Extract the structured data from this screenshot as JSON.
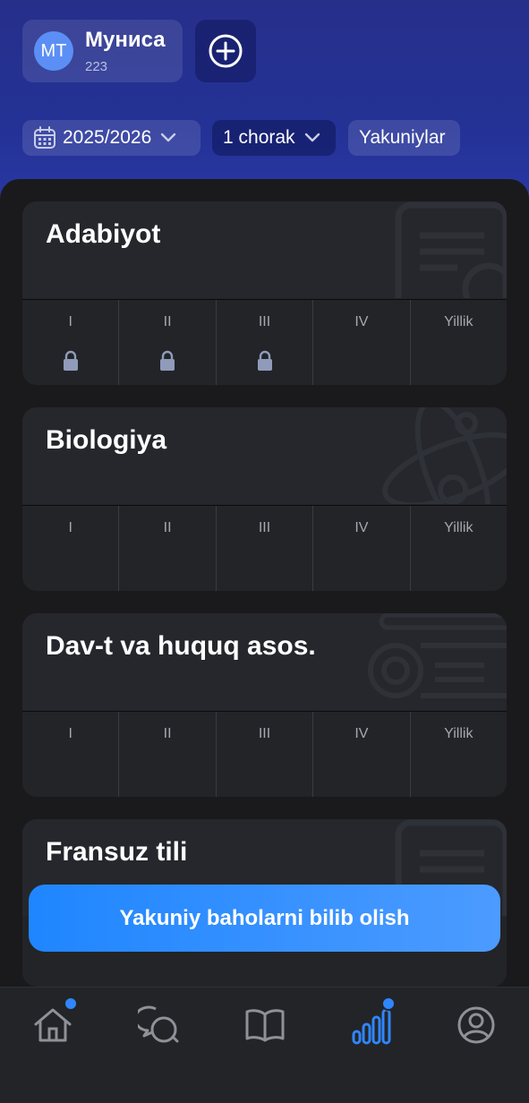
{
  "profile": {
    "initials": "MT",
    "name": "Муниса",
    "subtitle": "223"
  },
  "filters": {
    "year": "2025/2026",
    "quarter": "1 chorak",
    "results": "Yakuniylar"
  },
  "grade_columns": [
    "I",
    "II",
    "III",
    "IV",
    "Yillik"
  ],
  "subjects": [
    {
      "name": "Adabiyot",
      "locked": [
        true,
        true,
        true,
        false,
        false
      ]
    },
    {
      "name": "Biologiya",
      "locked": [
        false,
        false,
        false,
        false,
        false
      ]
    },
    {
      "name": "Dav-t va huquq asos.",
      "locked": [
        false,
        false,
        false,
        false,
        false
      ]
    },
    {
      "name": "Fransuz tili",
      "locked": [
        false,
        false,
        false,
        false,
        false
      ]
    }
  ],
  "cta": {
    "label": "Yakuniy baholarni bilib olish"
  },
  "tabbar": {
    "items": [
      {
        "icon": "home-icon",
        "badge": true,
        "active": false
      },
      {
        "icon": "chat-icon",
        "badge": false,
        "active": false
      },
      {
        "icon": "book-icon",
        "badge": false,
        "active": false
      },
      {
        "icon": "stats-icon",
        "badge": true,
        "active": true
      },
      {
        "icon": "profile-icon",
        "badge": false,
        "active": false
      }
    ]
  },
  "colors": {
    "accent": "#2f86ff",
    "header": "#243296",
    "card": "#222428",
    "panel": "#1a1a1c"
  }
}
